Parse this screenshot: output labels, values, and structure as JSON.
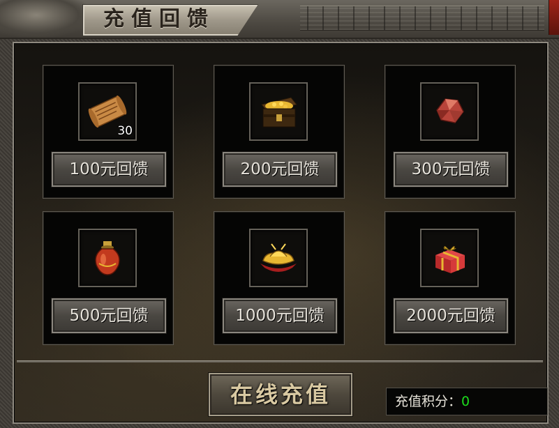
{
  "window": {
    "title": "充值回馈"
  },
  "rewards": [
    {
      "label": "100元回馈",
      "item_icon": "scroll-icon",
      "item_count": "30"
    },
    {
      "label": "200元回馈",
      "item_icon": "treasure-chest-icon",
      "item_count": ""
    },
    {
      "label": "300元回馈",
      "item_icon": "red-gem-icon",
      "item_count": ""
    },
    {
      "label": "500元回馈",
      "item_icon": "potion-jar-icon",
      "item_count": ""
    },
    {
      "label": "1000元回馈",
      "item_icon": "gold-ingot-icon",
      "item_count": ""
    },
    {
      "label": "2000元回馈",
      "item_icon": "gift-box-icon",
      "item_count": ""
    }
  ],
  "footer": {
    "recharge_label": "在线充值",
    "points_label": "充值积分：",
    "points_value": "0"
  },
  "colors": {
    "points_value": "#1cdc1c",
    "close_button": "#a02418"
  }
}
